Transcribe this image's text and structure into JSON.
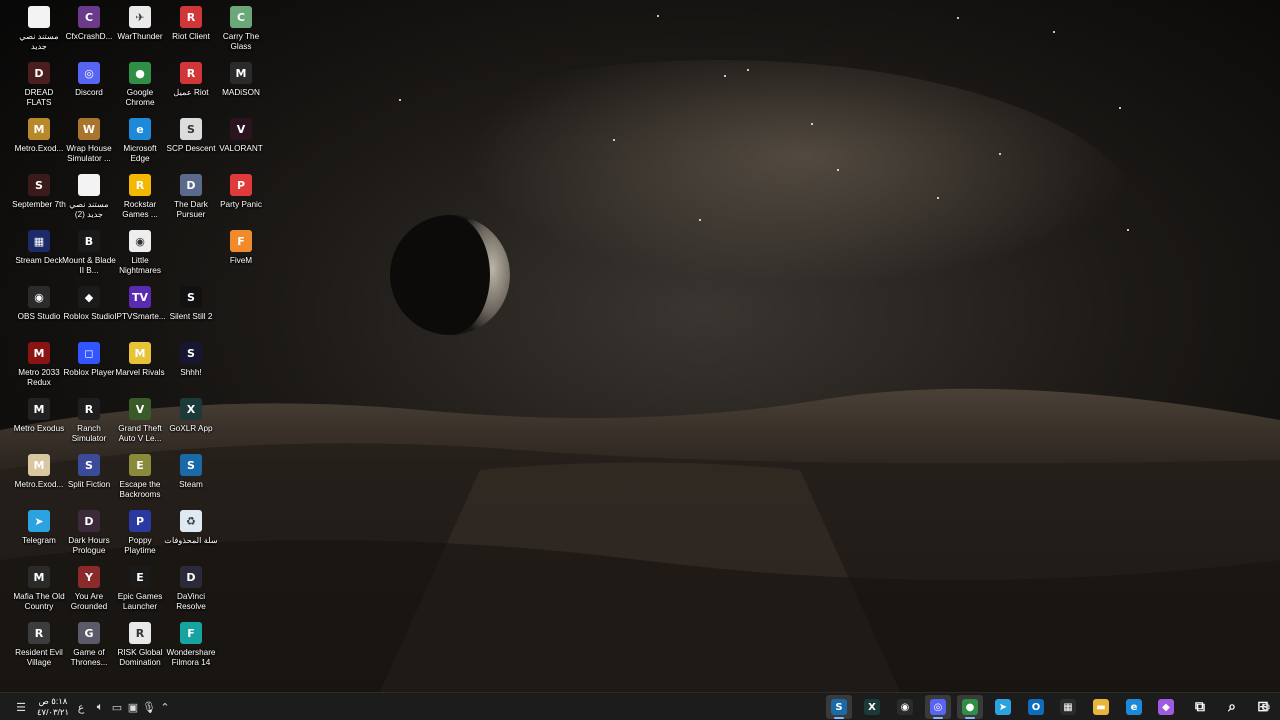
{
  "desktop": {
    "columns": [
      [
        {
          "label": "مستند نصي جديد",
          "icon": "text-document-icon",
          "color": "#f3f3f3",
          "glyph": ""
        },
        {
          "label": "DREAD FLATS",
          "icon": "dread-flats-icon",
          "color": "#4a1e1e",
          "glyph": "D"
        },
        {
          "label": "Metro.Exod...",
          "icon": "metro-exodus-icon",
          "color": "#b8892a",
          "glyph": "M"
        },
        {
          "label": "September 7th",
          "icon": "september-7th-icon",
          "color": "#3a1a1a",
          "glyph": "S"
        },
        {
          "label": "Stream Deck",
          "icon": "stream-deck-icon",
          "color": "#1d2a6a",
          "glyph": "▦"
        },
        {
          "label": "OBS Studio",
          "icon": "obs-studio-icon",
          "color": "#2b2b2b",
          "glyph": "◉"
        },
        {
          "label": "Metro 2033 Redux",
          "icon": "metro-2033-icon",
          "color": "#8a1414",
          "glyph": "M"
        },
        {
          "label": "Metro Exodus",
          "icon": "metro-exodus-2-icon",
          "color": "#222222",
          "glyph": "M"
        },
        {
          "label": "Metro.Exod...",
          "icon": "metro-exodus-3-icon",
          "color": "#d8c7a0",
          "glyph": "M"
        },
        {
          "label": "Telegram",
          "icon": "telegram-icon",
          "color": "#2aa3e0",
          "glyph": "➤"
        },
        {
          "label": "Mafia The Old Country",
          "icon": "mafia-icon",
          "color": "#2a2a2a",
          "glyph": "M"
        },
        {
          "label": "Resident Evil Village",
          "icon": "resident-evil-icon",
          "color": "#3c3c3c",
          "glyph": "R"
        }
      ],
      [
        {
          "label": "CfxCrashD...",
          "icon": "cfx-crash-dump-icon",
          "color": "#6b3a8a",
          "glyph": "C"
        },
        {
          "label": "Discord",
          "icon": "discord-icon",
          "color": "#5865f2",
          "glyph": "◎"
        },
        {
          "label": "Wrap House Simulator ...",
          "icon": "wrap-house-icon",
          "color": "#a8742e",
          "glyph": "W"
        },
        {
          "label": "مستند نصي جديد (2)",
          "icon": "text-document-2-icon",
          "color": "#f3f3f3",
          "glyph": ""
        },
        {
          "label": "Mount & Blade II B...",
          "icon": "mount-blade-icon",
          "color": "#1a1a1a",
          "glyph": "B"
        },
        {
          "label": "Roblox Studio",
          "icon": "roblox-studio-icon",
          "color": "#1b1b1b",
          "glyph": "◆"
        },
        {
          "label": "Roblox Player",
          "icon": "roblox-player-icon",
          "color": "#3355ff",
          "glyph": "◻"
        },
        {
          "label": "Ranch Simulator",
          "icon": "ranch-simulator-icon",
          "color": "#1e1e1e",
          "glyph": "R"
        },
        {
          "label": "Split Fiction",
          "icon": "split-fiction-icon",
          "color": "#3c4a9a",
          "glyph": "S"
        },
        {
          "label": "Dark Hours Prologue",
          "icon": "dark-hours-icon",
          "color": "#3a2a3a",
          "glyph": "D"
        },
        {
          "label": "You Are Grounded",
          "icon": "you-are-grounded-icon",
          "color": "#8a2a2a",
          "glyph": "Y"
        },
        {
          "label": "Game of Thrones...",
          "icon": "game-of-thrones-icon",
          "color": "#5a5a6a",
          "glyph": "G"
        }
      ],
      [
        {
          "label": "WarThunder",
          "icon": "war-thunder-icon",
          "color": "#eaeaea",
          "glyph": "✈"
        },
        {
          "label": "Google Chrome",
          "icon": "chrome-icon",
          "color": "#2f8f46",
          "glyph": "●"
        },
        {
          "label": "Microsoft Edge",
          "icon": "edge-icon",
          "color": "#1c8ad8",
          "glyph": "e"
        },
        {
          "label": "Rockstar Games ...",
          "icon": "rockstar-icon",
          "color": "#f5b800",
          "glyph": "R"
        },
        {
          "label": "Little Nightmares",
          "icon": "little-nightmares-icon",
          "color": "#eeeeee",
          "glyph": "◉"
        },
        {
          "label": "IPTVSmarte...",
          "icon": "iptv-smarters-icon",
          "color": "#5a2ab0",
          "glyph": "TV"
        },
        {
          "label": "Marvel Rivals",
          "icon": "marvel-rivals-icon",
          "color": "#e7c437",
          "glyph": "M"
        },
        {
          "label": "Grand Theft Auto V Le...",
          "icon": "gta-v-icon",
          "color": "#3a5a2a",
          "glyph": "V"
        },
        {
          "label": "Escape the Backrooms",
          "icon": "escape-backrooms-icon",
          "color": "#8a8a3a",
          "glyph": "E"
        },
        {
          "label": "Poppy Playtime",
          "icon": "poppy-playtime-icon",
          "color": "#2a3aa0",
          "glyph": "P"
        },
        {
          "label": "Epic Games Launcher",
          "icon": "epic-games-icon",
          "color": "#1a1a1a",
          "glyph": "E"
        },
        {
          "label": "RISK Global Domination",
          "icon": "risk-icon",
          "color": "#e8e8e8",
          "glyph": "R"
        }
      ],
      [
        {
          "label": "Riot Client",
          "icon": "riot-client-icon",
          "color": "#d13639",
          "glyph": "R"
        },
        {
          "label": "عميل Riot",
          "icon": "riot-client-2-icon",
          "color": "#d13639",
          "glyph": "R"
        },
        {
          "label": "SCP Descent",
          "icon": "scp-descent-icon",
          "color": "#dcdcdc",
          "glyph": "S"
        },
        {
          "label": "The Dark Pursuer",
          "icon": "dark-pursuer-icon",
          "color": "#5a6a8a",
          "glyph": "D"
        },
        {
          "label": "",
          "icon": "",
          "color": "",
          "glyph": ""
        },
        {
          "label": "Silent Still 2",
          "icon": "silent-still-icon",
          "color": "#111111",
          "glyph": "S"
        },
        {
          "label": "Shhh!",
          "icon": "shhh-icon",
          "color": "#161630",
          "glyph": "S"
        },
        {
          "label": "GoXLR App",
          "icon": "goxlr-icon",
          "color": "#1d3a3a",
          "glyph": "X"
        },
        {
          "label": "Steam",
          "icon": "steam-icon",
          "color": "#1b6aa8",
          "glyph": "S"
        },
        {
          "label": "سلة المحذوفات",
          "icon": "recycle-bin-icon",
          "color": "#dfe9f3",
          "glyph": "♻"
        },
        {
          "label": "DaVinci Resolve",
          "icon": "davinci-resolve-icon",
          "color": "#2a2a3a",
          "glyph": "D"
        },
        {
          "label": "Wondershare Filmora 14",
          "icon": "filmora-icon",
          "color": "#17a3a0",
          "glyph": "F"
        }
      ],
      [
        {
          "label": "Carry The Glass",
          "icon": "carry-the-glass-icon",
          "color": "#6aa87a",
          "glyph": "C"
        },
        {
          "label": "MADiSON",
          "icon": "madison-icon",
          "color": "#2a2a2a",
          "glyph": "M"
        },
        {
          "label": "VALORANT",
          "icon": "valorant-icon",
          "color": "#2a1420",
          "glyph": "V"
        },
        {
          "label": "Party Panic",
          "icon": "party-panic-icon",
          "color": "#e03a3a",
          "glyph": "P"
        },
        {
          "label": "FiveM",
          "icon": "fivem-icon",
          "color": "#f08a2a",
          "glyph": "F"
        }
      ]
    ]
  },
  "taskbar": {
    "clock_time": "٥:١٨ ص",
    "clock_date": "٤٧/٠٣/٢١",
    "lang": "ع",
    "pinned": [
      {
        "name": "steam-taskbar",
        "icon": "steam-icon",
        "color": "#1b6aa8",
        "glyph": "S",
        "active": true
      },
      {
        "name": "goxlr-taskbar",
        "icon": "goxlr-icon",
        "color": "#1d3a3a",
        "glyph": "X",
        "active": false
      },
      {
        "name": "obs-taskbar",
        "icon": "obs-studio-icon",
        "color": "#2b2b2b",
        "glyph": "◉",
        "active": false
      },
      {
        "name": "discord-taskbar",
        "icon": "discord-icon",
        "color": "#5865f2",
        "glyph": "◎",
        "active": true
      },
      {
        "name": "chrome-taskbar",
        "icon": "chrome-icon",
        "color": "#2f8f46",
        "glyph": "●",
        "active": true
      },
      {
        "name": "telegram-taskbar",
        "icon": "telegram-icon",
        "color": "#2aa3e0",
        "glyph": "➤",
        "active": false
      },
      {
        "name": "outlook-taskbar",
        "icon": "outlook-icon",
        "color": "#0f6cbd",
        "glyph": "O",
        "active": false
      },
      {
        "name": "store-taskbar",
        "icon": "store-icon",
        "color": "#2b2b2b",
        "glyph": "▦",
        "active": false
      },
      {
        "name": "explorer-taskbar",
        "icon": "folder-icon",
        "color": "#e8b43a",
        "glyph": "▬",
        "active": false
      },
      {
        "name": "edge-taskbar",
        "icon": "edge-icon",
        "color": "#1c8ad8",
        "glyph": "e",
        "active": false
      },
      {
        "name": "copilot-taskbar",
        "icon": "copilot-icon",
        "color": "#a05ae0",
        "glyph": "◆",
        "active": false
      },
      {
        "name": "taskview-taskbar",
        "icon": "task-view-icon",
        "color": "transparent",
        "glyph": "⧉",
        "active": false
      },
      {
        "name": "search-taskbar",
        "icon": "search-icon",
        "color": "transparent",
        "glyph": "⌕",
        "active": false
      },
      {
        "name": "start-taskbar",
        "icon": "start-icon",
        "color": "transparent",
        "glyph": "⊞",
        "active": false
      }
    ]
  }
}
